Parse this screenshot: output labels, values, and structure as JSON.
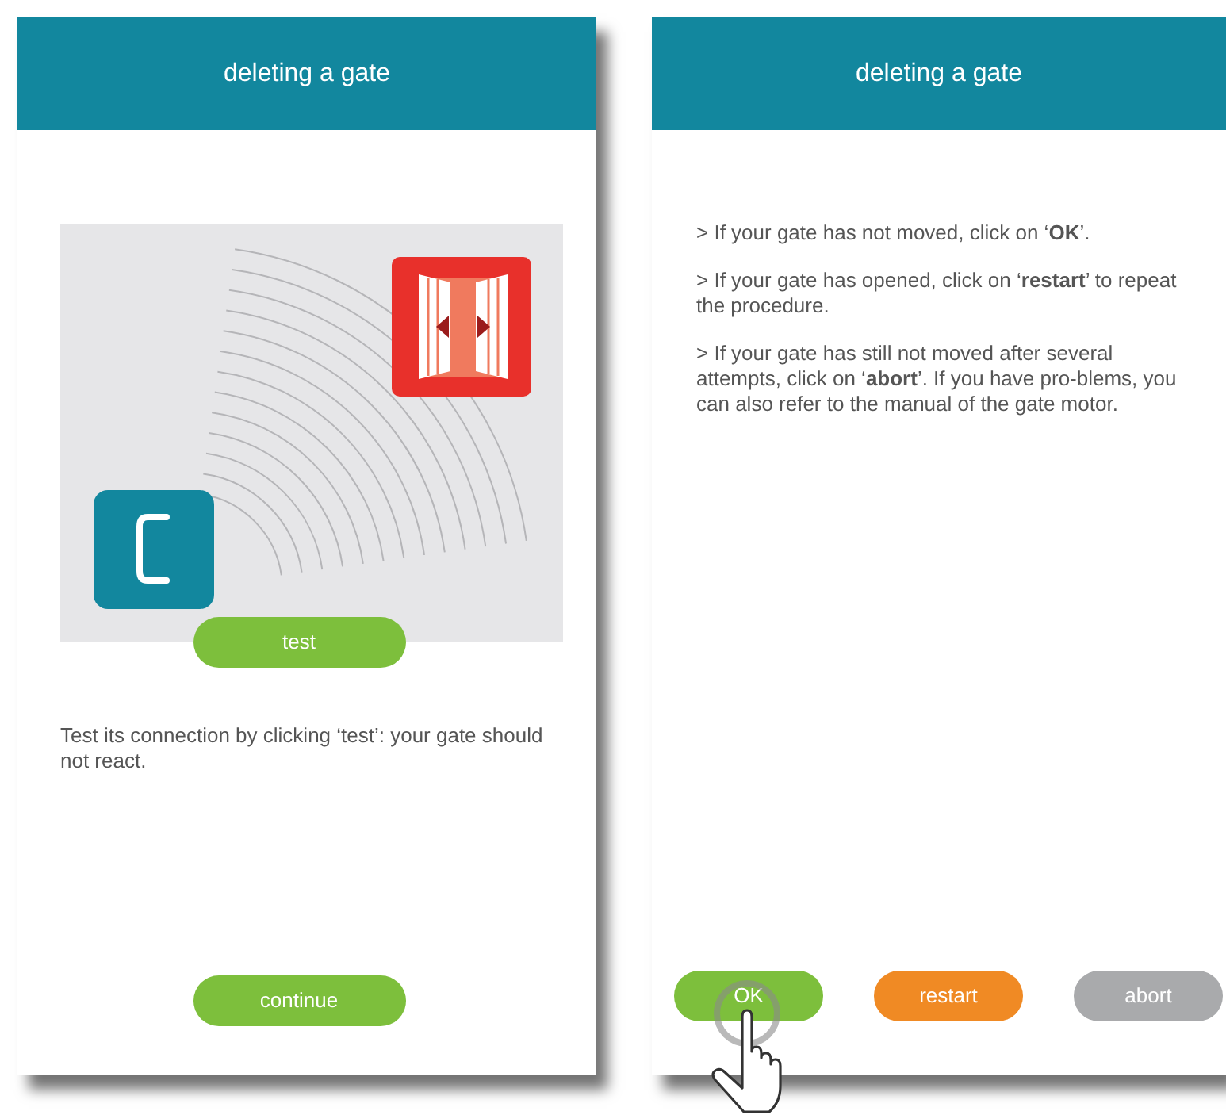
{
  "screens": [
    {
      "kind": "test",
      "title": "deleting a gate",
      "test_button": "test",
      "instruction": "Test its connection by clicking ‘test’: your gate should not react.",
      "continue_button": "continue"
    },
    {
      "kind": "options",
      "title": "deleting a gate",
      "paragraphs": [
        "> If your gate has not moved, click on ‘**OK**’.",
        "> If your gate has opened, click on ‘**restart**’ to repeat the procedure.",
        "> If your gate has still not moved after several attempts, click on ‘**abort**’. If you have pro-blems, you can also refer to the manual of the gate motor."
      ],
      "buttons": [
        {
          "label": "OK",
          "color": "#7dbf3c",
          "pointer": true
        },
        {
          "label": "restart",
          "color": "#f08a24",
          "pointer": false
        },
        {
          "label": "abort",
          "color": "#a9aaac",
          "pointer": false
        }
      ]
    }
  ]
}
